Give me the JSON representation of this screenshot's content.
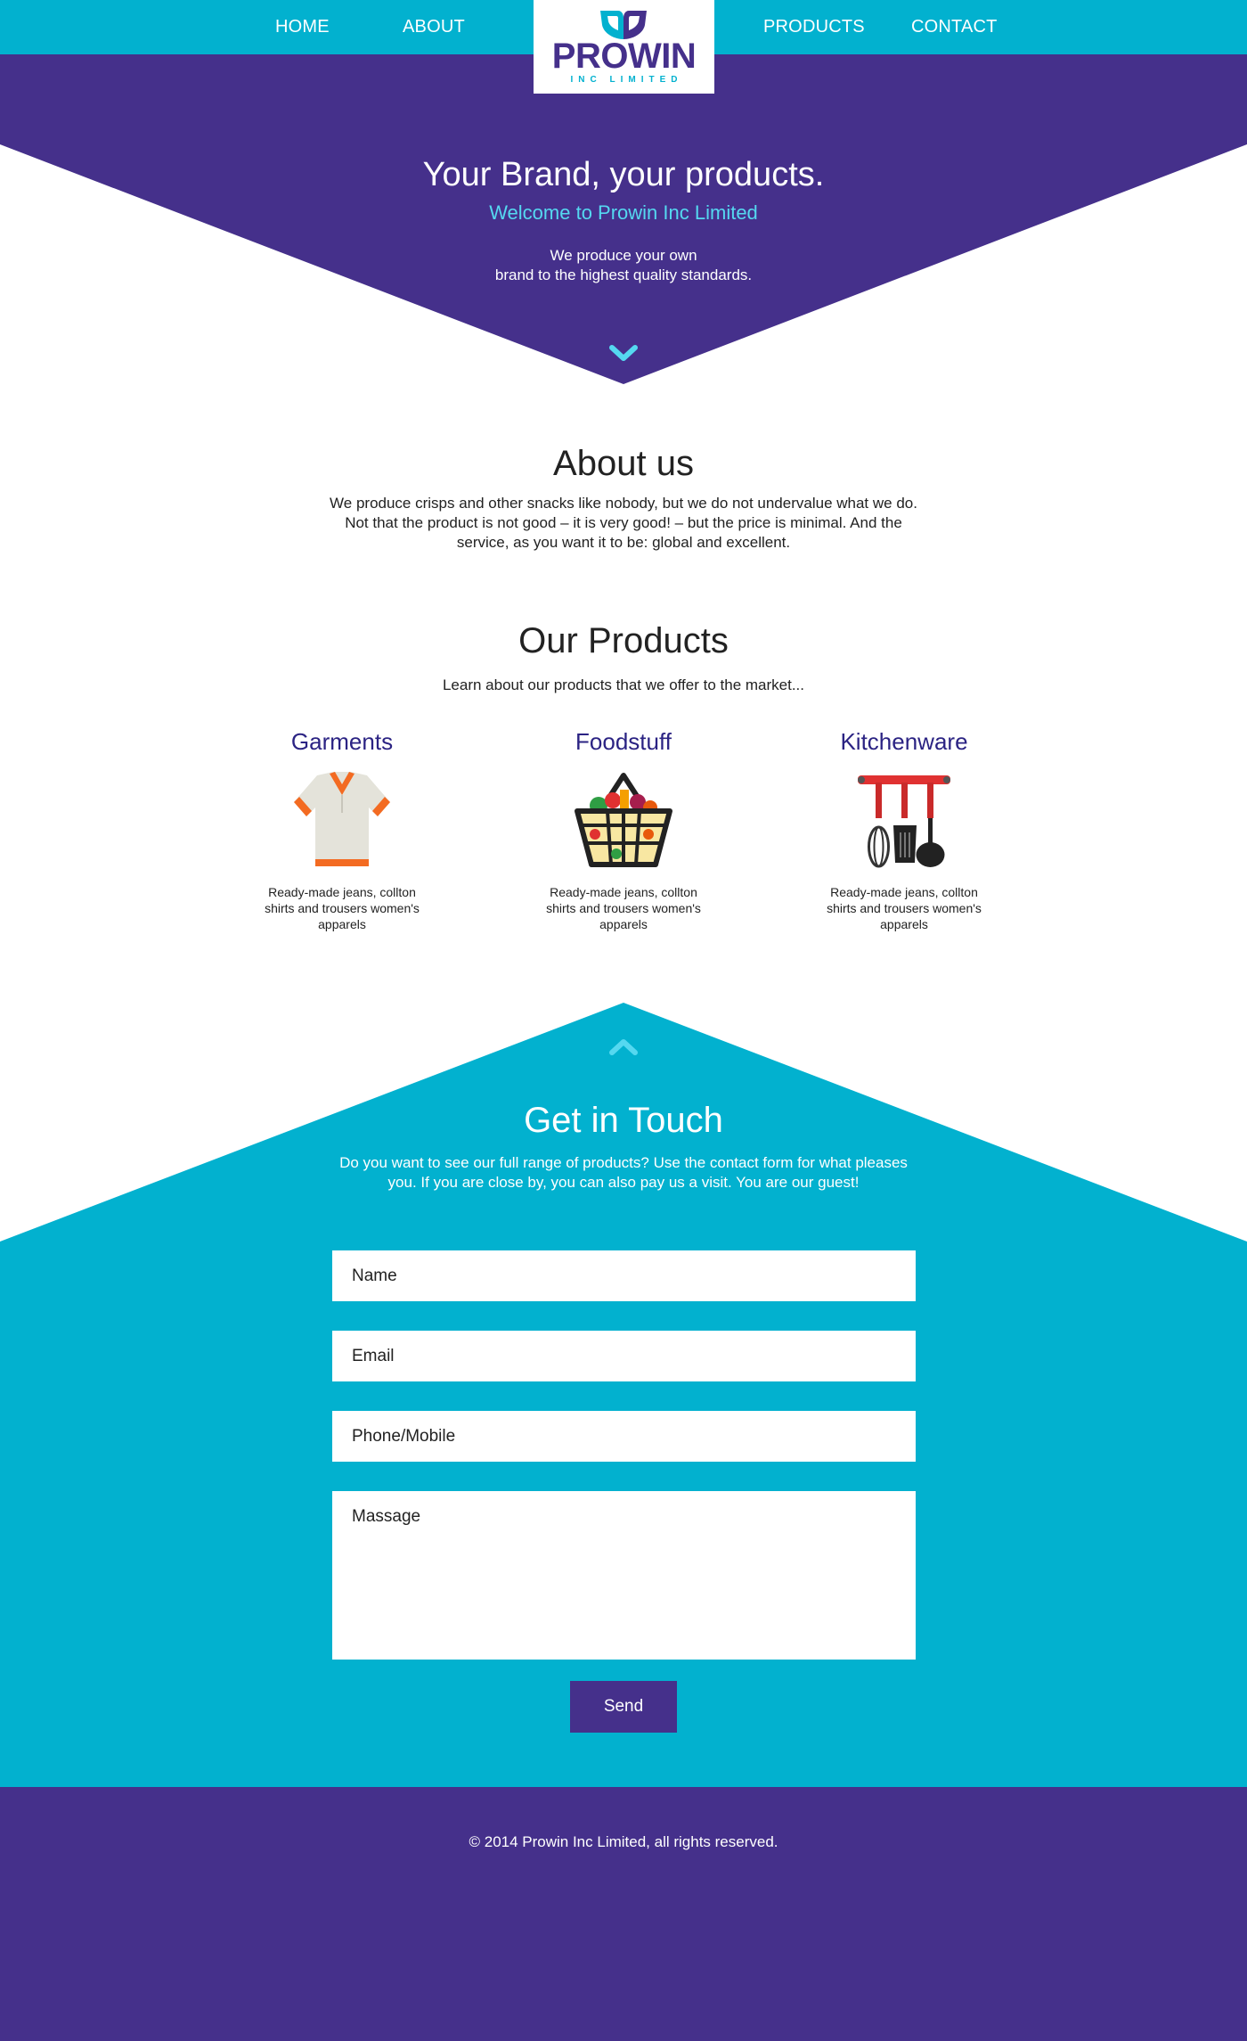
{
  "nav": {
    "items": [
      {
        "label": "HOME"
      },
      {
        "label": "ABOUT"
      },
      {
        "label": "PRODUCTS"
      },
      {
        "label": "CONTACT"
      }
    ]
  },
  "logo": {
    "name": "PROWIN",
    "tagline": "INC LIMITED",
    "icon": "prowin-leaf-logo-icon"
  },
  "hero": {
    "title": "Your Brand, your products.",
    "subtitle": "Welcome to Prowin Inc Limited",
    "line1": "We produce your own",
    "line2": "brand to the highest quality standards.",
    "scroll_icon": "chevron-down-icon"
  },
  "about": {
    "title": "About us",
    "line1": "We produce crisps and other snacks like nobody, but we do not undervalue what we do.",
    "line2": "Not that the product is not good – it is very good! – but the price is minimal. And the",
    "line3": "service, as you want it to be: global and excellent."
  },
  "products": {
    "title": "Our Products",
    "subtitle": "Learn about our products that we offer to the market...",
    "items": [
      {
        "title": "Garments",
        "icon": "shirt-icon",
        "desc1": "Ready-made jeans, collton",
        "desc2": "shirts and trousers women's",
        "desc3": "apparels"
      },
      {
        "title": "Foodstuff",
        "icon": "shopping-basket-icon",
        "desc1": "Ready-made jeans, collton",
        "desc2": "shirts and trousers women's",
        "desc3": "apparels"
      },
      {
        "title": "Kitchenware",
        "icon": "kitchen-utensils-icon",
        "desc1": "Ready-made jeans, collton",
        "desc2": "shirts and trousers women's",
        "desc3": "apparels"
      }
    ]
  },
  "contact": {
    "scroll_icon": "chevron-up-icon",
    "title": "Get in Touch",
    "line1": "Do you want to see our full range of products? Use the contact form for what pleases",
    "line2": "you. If you are close by, you can also pay us a visit. You are our guest!",
    "name_placeholder": "Name",
    "email_placeholder": "Email",
    "phone_placeholder": "Phone/Mobile",
    "message_placeholder": "Massage",
    "send_label": "Send"
  },
  "footer": {
    "copyright": "© 2014 Prowin Inc Limited, all rights reserved."
  },
  "colors": {
    "cyan": "#02b1cf",
    "purple": "#45308b",
    "light_cyan": "#55d8f0",
    "product_title": "#2b2383"
  }
}
